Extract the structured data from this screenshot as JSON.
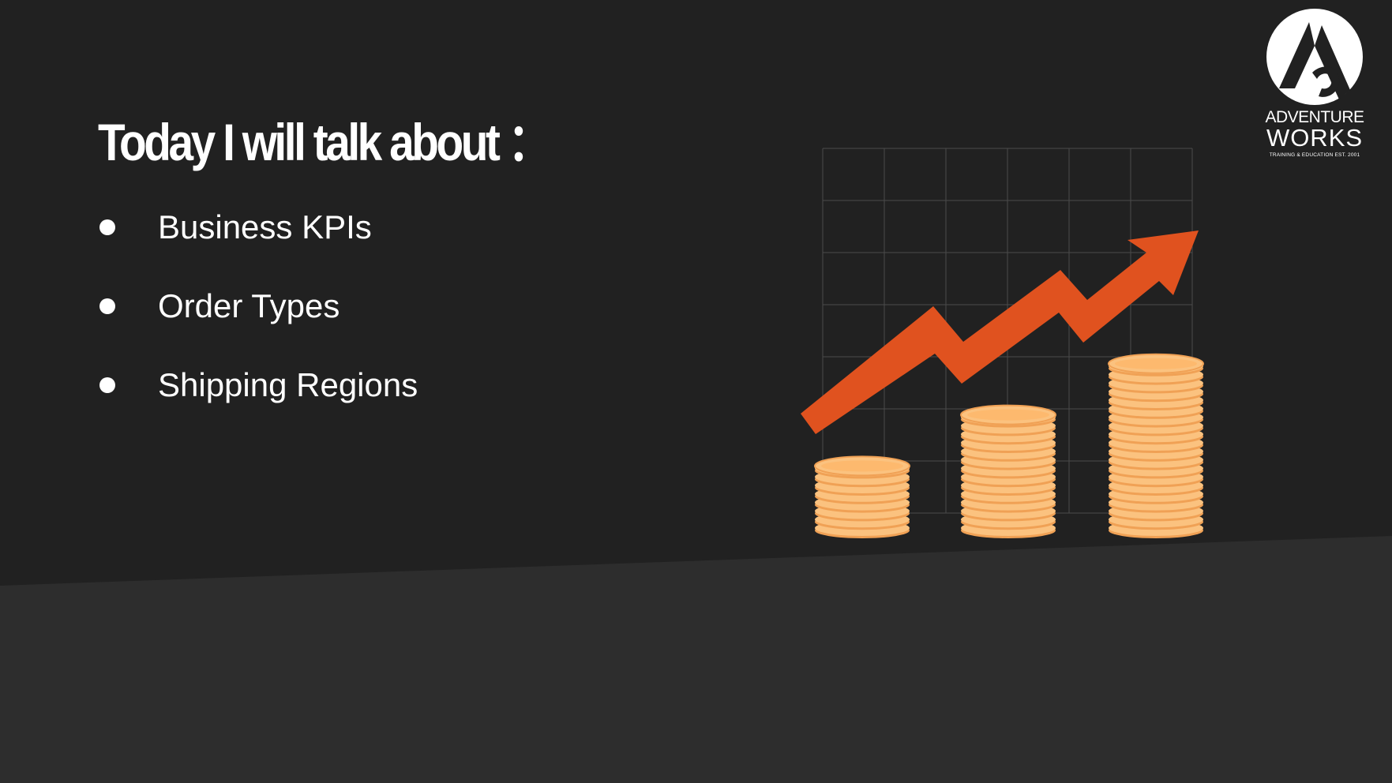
{
  "slide": {
    "title": "Today I will talk about ：",
    "bullets": [
      {
        "label": "Business KPIs"
      },
      {
        "label": "Order Types"
      },
      {
        "label": "Shipping Regions"
      }
    ]
  },
  "logo": {
    "line1": "ADVENTURE",
    "line2": "WORKS",
    "tagline": "TRAINING & EDUCATION   EST. 2001"
  },
  "colors": {
    "background": "#212121",
    "bottom_band": "#2d2d2d",
    "arrow": "#e0521f",
    "coin_body": "#fbc27f",
    "coin_edge": "#f0a155",
    "coin_top": "#fdb96e",
    "grid": "#4a4a4a",
    "text": "#ffffff"
  }
}
